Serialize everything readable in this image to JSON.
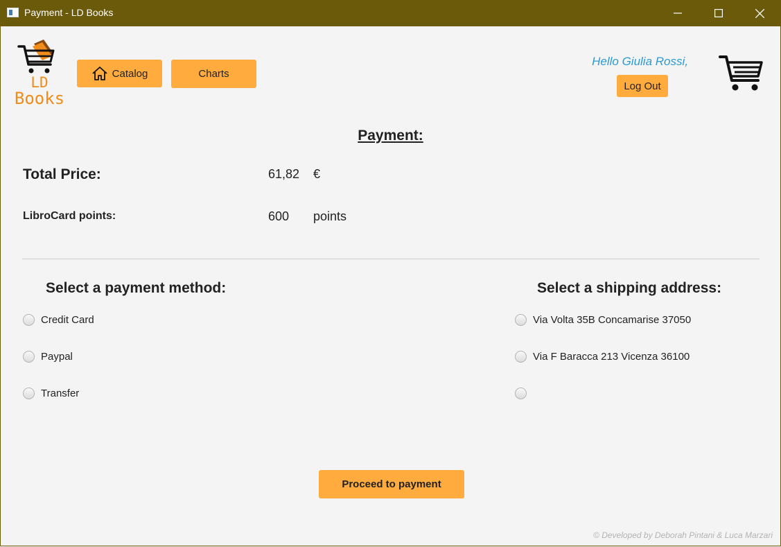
{
  "window": {
    "title": "Payment - LD Books",
    "minimize_icon": "minimize-icon",
    "maximize_icon": "maximize-icon",
    "close_icon": "close-icon"
  },
  "header": {
    "logo": {
      "line1": "LD",
      "line2": "Books",
      "icon": "shopping-cart-books-icon"
    },
    "catalog_label": "Catalog",
    "catalog_icon": "home-icon",
    "charts_label": "Charts",
    "greeting": "Hello Giulia Rossi,",
    "logout_label": "Log Out",
    "cart_icon": "shopping-cart-icon"
  },
  "payment": {
    "title": "Payment:",
    "total_price_label": "Total Price:",
    "total_price_value": "61,82",
    "currency": "€",
    "points_label": "LibroCard points:",
    "points_value": "600",
    "points_unit": "points"
  },
  "payment_methods": {
    "heading": "Select a payment method:",
    "options": [
      "Credit Card",
      "Paypal",
      "Transfer"
    ]
  },
  "shipping": {
    "heading": "Select a shipping address:",
    "options": [
      "Via Volta 35B Concamarise 37050",
      "Via F Baracca 213 Vicenza 36100",
      ""
    ]
  },
  "proceed_label": "Proceed to payment",
  "footer": "© Developed by Deborah Pintani & Luca Marzari",
  "colors": {
    "accent": "#ffab3d",
    "titlebar": "#6b5a0a",
    "greeting": "#2c9ad1",
    "logo": "#f08c1a"
  }
}
